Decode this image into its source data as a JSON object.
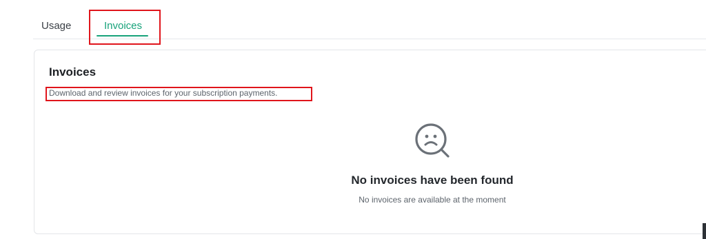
{
  "tabs": [
    {
      "label": "Usage",
      "active": false
    },
    {
      "label": "Invoices",
      "active": true
    }
  ],
  "colors": {
    "accent": "#17a27a",
    "highlight": "#e0141b"
  },
  "card": {
    "title": "Invoices",
    "subtitle": "Download and review invoices for your subscription payments."
  },
  "empty_state": {
    "icon": "sad-face-search-icon",
    "title": "No invoices have been found",
    "subtitle": "No invoices are available at the moment"
  }
}
